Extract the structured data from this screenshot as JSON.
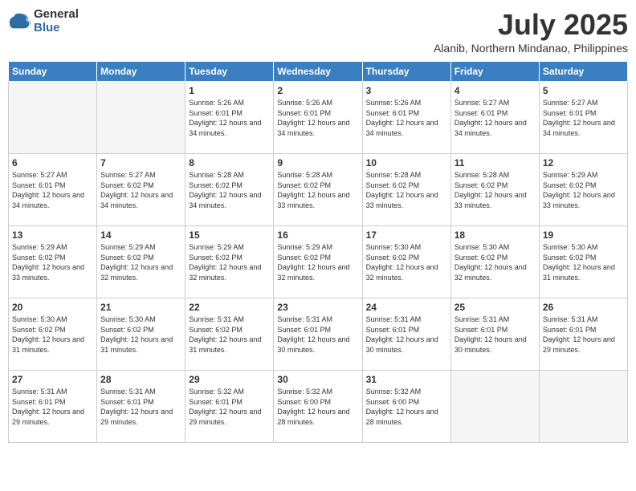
{
  "logo": {
    "general": "General",
    "blue": "Blue"
  },
  "title": "July 2025",
  "location": "Alanib, Northern Mindanao, Philippines",
  "days": [
    "Sunday",
    "Monday",
    "Tuesday",
    "Wednesday",
    "Thursday",
    "Friday",
    "Saturday"
  ],
  "weeks": [
    [
      {
        "day": "",
        "empty": true
      },
      {
        "day": "",
        "empty": true
      },
      {
        "day": "1",
        "sunrise": "5:26 AM",
        "sunset": "6:01 PM",
        "daylight": "12 hours and 34 minutes."
      },
      {
        "day": "2",
        "sunrise": "5:26 AM",
        "sunset": "6:01 PM",
        "daylight": "12 hours and 34 minutes."
      },
      {
        "day": "3",
        "sunrise": "5:26 AM",
        "sunset": "6:01 PM",
        "daylight": "12 hours and 34 minutes."
      },
      {
        "day": "4",
        "sunrise": "5:27 AM",
        "sunset": "6:01 PM",
        "daylight": "12 hours and 34 minutes."
      },
      {
        "day": "5",
        "sunrise": "5:27 AM",
        "sunset": "6:01 PM",
        "daylight": "12 hours and 34 minutes."
      }
    ],
    [
      {
        "day": "6",
        "sunrise": "5:27 AM",
        "sunset": "6:01 PM",
        "daylight": "12 hours and 34 minutes."
      },
      {
        "day": "7",
        "sunrise": "5:27 AM",
        "sunset": "6:02 PM",
        "daylight": "12 hours and 34 minutes."
      },
      {
        "day": "8",
        "sunrise": "5:28 AM",
        "sunset": "6:02 PM",
        "daylight": "12 hours and 34 minutes."
      },
      {
        "day": "9",
        "sunrise": "5:28 AM",
        "sunset": "6:02 PM",
        "daylight": "12 hours and 33 minutes."
      },
      {
        "day": "10",
        "sunrise": "5:28 AM",
        "sunset": "6:02 PM",
        "daylight": "12 hours and 33 minutes."
      },
      {
        "day": "11",
        "sunrise": "5:28 AM",
        "sunset": "6:02 PM",
        "daylight": "12 hours and 33 minutes."
      },
      {
        "day": "12",
        "sunrise": "5:29 AM",
        "sunset": "6:02 PM",
        "daylight": "12 hours and 33 minutes."
      }
    ],
    [
      {
        "day": "13",
        "sunrise": "5:29 AM",
        "sunset": "6:02 PM",
        "daylight": "12 hours and 33 minutes."
      },
      {
        "day": "14",
        "sunrise": "5:29 AM",
        "sunset": "6:02 PM",
        "daylight": "12 hours and 32 minutes."
      },
      {
        "day": "15",
        "sunrise": "5:29 AM",
        "sunset": "6:02 PM",
        "daylight": "12 hours and 32 minutes."
      },
      {
        "day": "16",
        "sunrise": "5:29 AM",
        "sunset": "6:02 PM",
        "daylight": "12 hours and 32 minutes."
      },
      {
        "day": "17",
        "sunrise": "5:30 AM",
        "sunset": "6:02 PM",
        "daylight": "12 hours and 32 minutes."
      },
      {
        "day": "18",
        "sunrise": "5:30 AM",
        "sunset": "6:02 PM",
        "daylight": "12 hours and 32 minutes."
      },
      {
        "day": "19",
        "sunrise": "5:30 AM",
        "sunset": "6:02 PM",
        "daylight": "12 hours and 31 minutes."
      }
    ],
    [
      {
        "day": "20",
        "sunrise": "5:30 AM",
        "sunset": "6:02 PM",
        "daylight": "12 hours and 31 minutes."
      },
      {
        "day": "21",
        "sunrise": "5:30 AM",
        "sunset": "6:02 PM",
        "daylight": "12 hours and 31 minutes."
      },
      {
        "day": "22",
        "sunrise": "5:31 AM",
        "sunset": "6:02 PM",
        "daylight": "12 hours and 31 minutes."
      },
      {
        "day": "23",
        "sunrise": "5:31 AM",
        "sunset": "6:01 PM",
        "daylight": "12 hours and 30 minutes."
      },
      {
        "day": "24",
        "sunrise": "5:31 AM",
        "sunset": "6:01 PM",
        "daylight": "12 hours and 30 minutes."
      },
      {
        "day": "25",
        "sunrise": "5:31 AM",
        "sunset": "6:01 PM",
        "daylight": "12 hours and 30 minutes."
      },
      {
        "day": "26",
        "sunrise": "5:31 AM",
        "sunset": "6:01 PM",
        "daylight": "12 hours and 29 minutes."
      }
    ],
    [
      {
        "day": "27",
        "sunrise": "5:31 AM",
        "sunset": "6:01 PM",
        "daylight": "12 hours and 29 minutes."
      },
      {
        "day": "28",
        "sunrise": "5:31 AM",
        "sunset": "6:01 PM",
        "daylight": "12 hours and 29 minutes."
      },
      {
        "day": "29",
        "sunrise": "5:32 AM",
        "sunset": "6:01 PM",
        "daylight": "12 hours and 29 minutes."
      },
      {
        "day": "30",
        "sunrise": "5:32 AM",
        "sunset": "6:00 PM",
        "daylight": "12 hours and 28 minutes."
      },
      {
        "day": "31",
        "sunrise": "5:32 AM",
        "sunset": "6:00 PM",
        "daylight": "12 hours and 28 minutes."
      },
      {
        "day": "",
        "empty": true
      },
      {
        "day": "",
        "empty": true
      }
    ]
  ]
}
